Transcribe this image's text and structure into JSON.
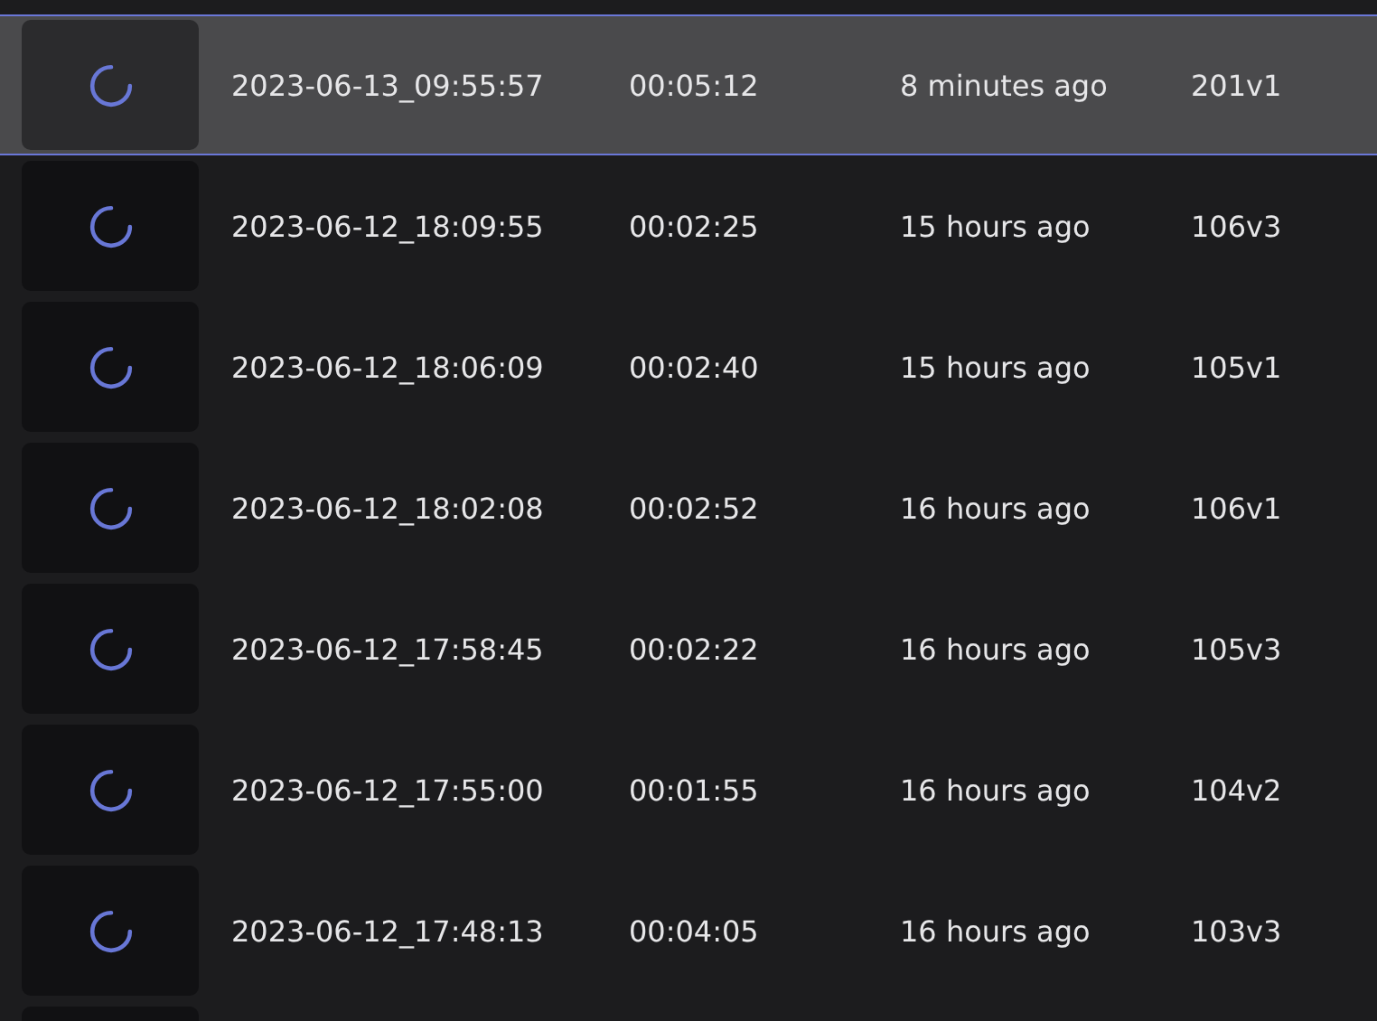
{
  "recordings": [
    {
      "name": "2023-06-13_09:55:57",
      "duration": "00:05:12",
      "age": "8 minutes ago",
      "version": "201v1",
      "selected": true
    },
    {
      "name": "2023-06-12_18:09:55",
      "duration": "00:02:25",
      "age": "15 hours ago",
      "version": "106v3",
      "selected": false
    },
    {
      "name": "2023-06-12_18:06:09",
      "duration": "00:02:40",
      "age": "15 hours ago",
      "version": "105v1",
      "selected": false
    },
    {
      "name": "2023-06-12_18:02:08",
      "duration": "00:02:52",
      "age": "16 hours ago",
      "version": "106v1",
      "selected": false
    },
    {
      "name": "2023-06-12_17:58:45",
      "duration": "00:02:22",
      "age": "16 hours ago",
      "version": "105v3",
      "selected": false
    },
    {
      "name": "2023-06-12_17:55:00",
      "duration": "00:01:55",
      "age": "16 hours ago",
      "version": "104v2",
      "selected": false
    },
    {
      "name": "2023-06-12_17:48:13",
      "duration": "00:04:05",
      "age": "16 hours ago",
      "version": "103v3",
      "selected": false
    }
  ]
}
